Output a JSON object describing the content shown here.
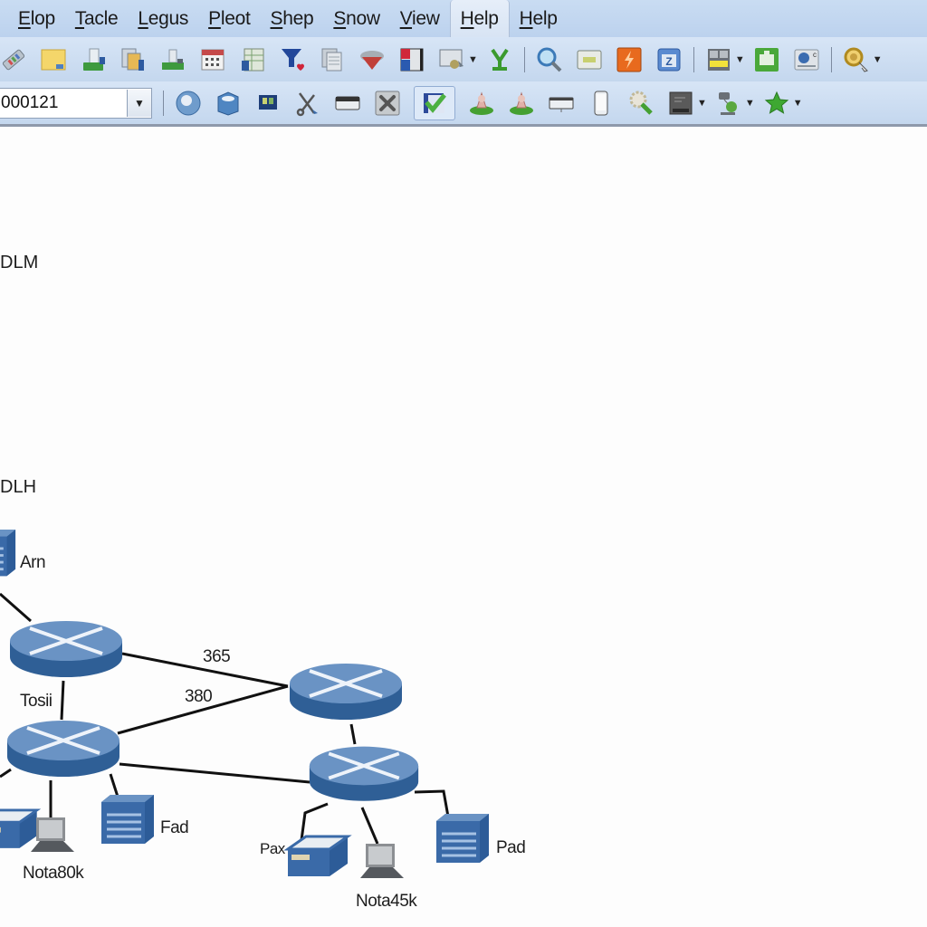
{
  "menubar": {
    "items": [
      {
        "label": "Elop",
        "mnemonic": "E",
        "active": false
      },
      {
        "label": "Tacle",
        "mnemonic": "T",
        "active": false
      },
      {
        "label": "Legus",
        "mnemonic": "L",
        "active": false
      },
      {
        "label": "Pleot",
        "mnemonic": "P",
        "active": false
      },
      {
        "label": "Shep",
        "mnemonic": "S",
        "active": false
      },
      {
        "label": "Snow",
        "mnemonic": "S",
        "active": false
      },
      {
        "label": "View",
        "mnemonic": "V",
        "active": false
      },
      {
        "label": "Help",
        "mnemonic": "H",
        "active": true
      },
      {
        "label": "Help",
        "mnemonic": "H",
        "active": false
      }
    ]
  },
  "toolbar1": {
    "icons": [
      "pencil-ruler-icon",
      "folder-icon",
      "print-green-icon",
      "copy-document-icon",
      "printer-icon",
      "calendar-icon",
      "spreadsheet-icon",
      "funnel-heart-icon",
      "stack-pages-icon",
      "filter-cone-icon",
      "columns-red-blue-icon",
      "certificate-icon",
      "y-green-icon",
      "magnifier-icon",
      "panel-icon",
      "lightning-icon",
      "text-box-icon",
      "layout-icon",
      "green-chart-icon",
      "oc-icon",
      "search-gold-icon"
    ]
  },
  "toolbar2": {
    "combo_value": "000121",
    "icons": [
      "globe-icon",
      "database-icon",
      "window-icon",
      "scissors-icon",
      "strip-icon",
      "tools-icon",
      "checkmark-icon",
      "user-a-icon",
      "user-b-icon",
      "monitor-icon",
      "phone-icon",
      "gear-wrench-icon",
      "terminal-icon",
      "network-node-icon",
      "star-icon"
    ]
  },
  "canvas": {
    "labels": {
      "dlm": "DLM",
      "dlh": "DLH",
      "arn": "Arn"
    },
    "edges": {
      "e1": "365",
      "e2": "380"
    },
    "nodes": {
      "tosii": "Tosii",
      "fad": "Fad",
      "nota80k": "Nota80k",
      "pax": "Pax",
      "pad": "Pad",
      "nota45k": "Nota45k"
    }
  },
  "colors": {
    "router_top": "#6a93c4",
    "router_side": "#2f5f96",
    "server": "#3a6aa8",
    "menubar": "#c3d7f0"
  }
}
